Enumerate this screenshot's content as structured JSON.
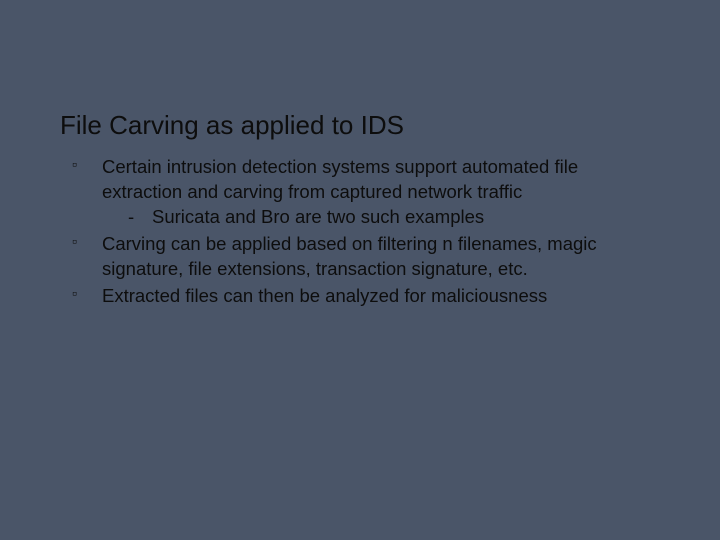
{
  "slide": {
    "title": "File Carving as applied to IDS",
    "bullets": [
      {
        "text": "Certain intrusion detection systems support automated file extraction and carving from captured network traffic",
        "sub": [
          "Suricata and Bro are two such examples"
        ]
      },
      {
        "text": "Carving can be applied based on filtering n filenames, magic signature, file extensions, transaction signature, etc."
      },
      {
        "text": "Extracted files can then be analyzed for maliciousness"
      }
    ]
  }
}
